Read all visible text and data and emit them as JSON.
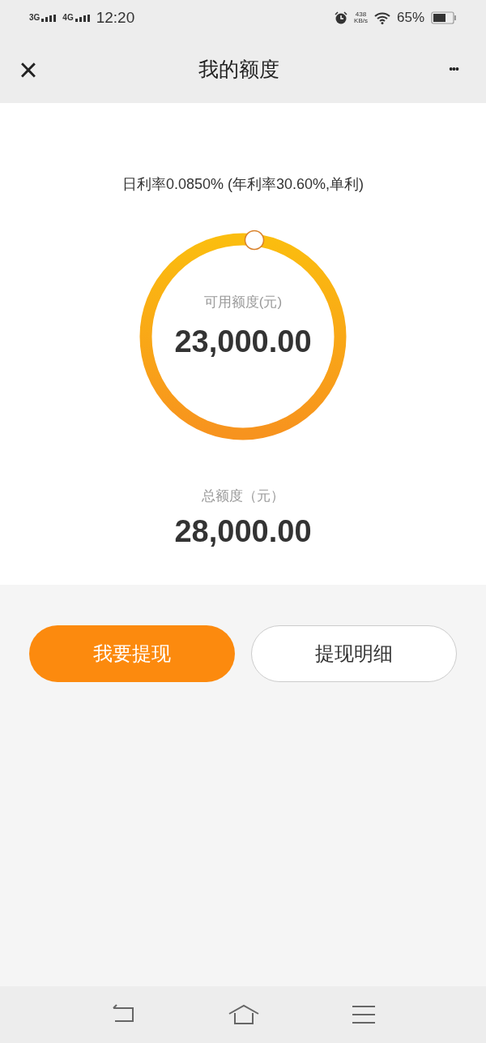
{
  "status_bar": {
    "network_1": "3G",
    "network_2": "4G",
    "time": "12:20",
    "speed_value": "438",
    "speed_unit": "KB/s",
    "battery": "65%"
  },
  "header": {
    "title": "我的额度",
    "close": "×",
    "more": "•••"
  },
  "rate": "日利率0.0850% (年利率30.60%,单利)",
  "available": {
    "label": "可用额度(元)",
    "amount": "23,000.00"
  },
  "total": {
    "label": "总额度（元）",
    "amount": "28,000.00"
  },
  "buttons": [
    {
      "label": "我要提现",
      "kind": "primary"
    },
    {
      "label": "提现明细",
      "kind": "outline"
    }
  ]
}
